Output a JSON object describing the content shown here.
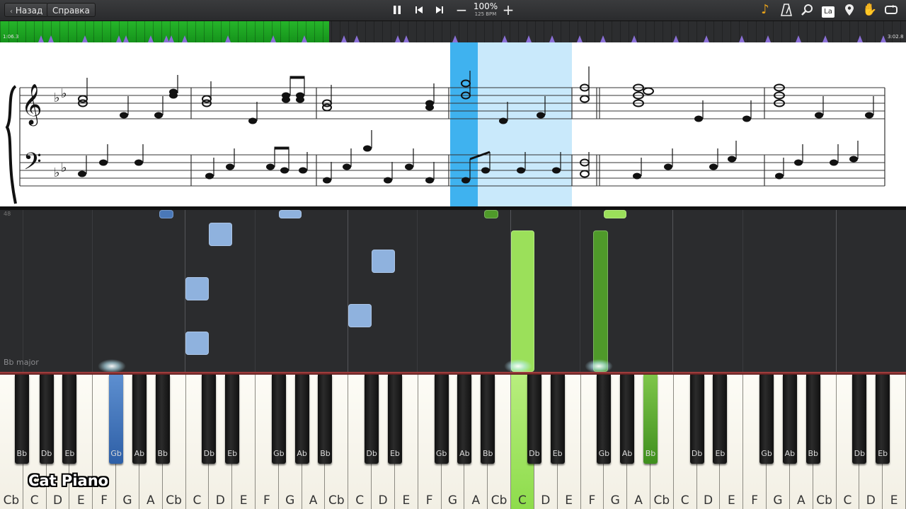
{
  "toolbar": {
    "back_label": "Назад",
    "help_label": "Справка",
    "speed_percent": "100%",
    "tempo": "125 BPM",
    "solfege_label": "La"
  },
  "icons": {
    "back": "chevron-left-icon",
    "pause": "pause-icon",
    "prev": "skip-previous-icon",
    "next": "skip-next-icon",
    "slower": "minus-icon",
    "faster": "plus-icon",
    "note": "music-note-icon",
    "metronome": "metronome-icon",
    "search": "magnifier-icon",
    "marker": "location-pin-icon",
    "hand": "hand-icon",
    "loop": "loop-icon"
  },
  "timeline": {
    "start_time": "1:06.3",
    "end_time": "3:02.8",
    "progress": 0.363,
    "fill_color": "#1ea823",
    "marker_color": "#8a6fd6"
  },
  "roll": {
    "key_label": "Bb major",
    "octave_number": "48",
    "left_hand_color": "#8fb2de",
    "right_hand_color": "#9be05a"
  },
  "keyboard": {
    "white_keys": [
      "Cb",
      "C",
      "D",
      "E",
      "F",
      "G",
      "A",
      "Cb",
      "C",
      "D",
      "E",
      "F",
      "G",
      "A",
      "Cb",
      "C",
      "D",
      "E",
      "F",
      "G",
      "A",
      "Cb",
      "C",
      "D",
      "E",
      "F",
      "G",
      "A",
      "Cb",
      "C",
      "D",
      "E",
      "F",
      "G",
      "A",
      "Cb",
      "C",
      "D",
      "E"
    ],
    "black_keys": [
      "Bb",
      "Db",
      "Eb",
      "Gb",
      "Ab",
      "Bb",
      "Db",
      "Eb",
      "Gb",
      "Ab",
      "Bb",
      "Db",
      "Eb",
      "Gb",
      "Ab",
      "Bb",
      "Db",
      "Eb",
      "Gb",
      "Ab",
      "Bb",
      "Db",
      "Eb",
      "Gb",
      "Ab",
      "Bb",
      "Db",
      "Eb"
    ]
  },
  "channel": "Cat Piano"
}
